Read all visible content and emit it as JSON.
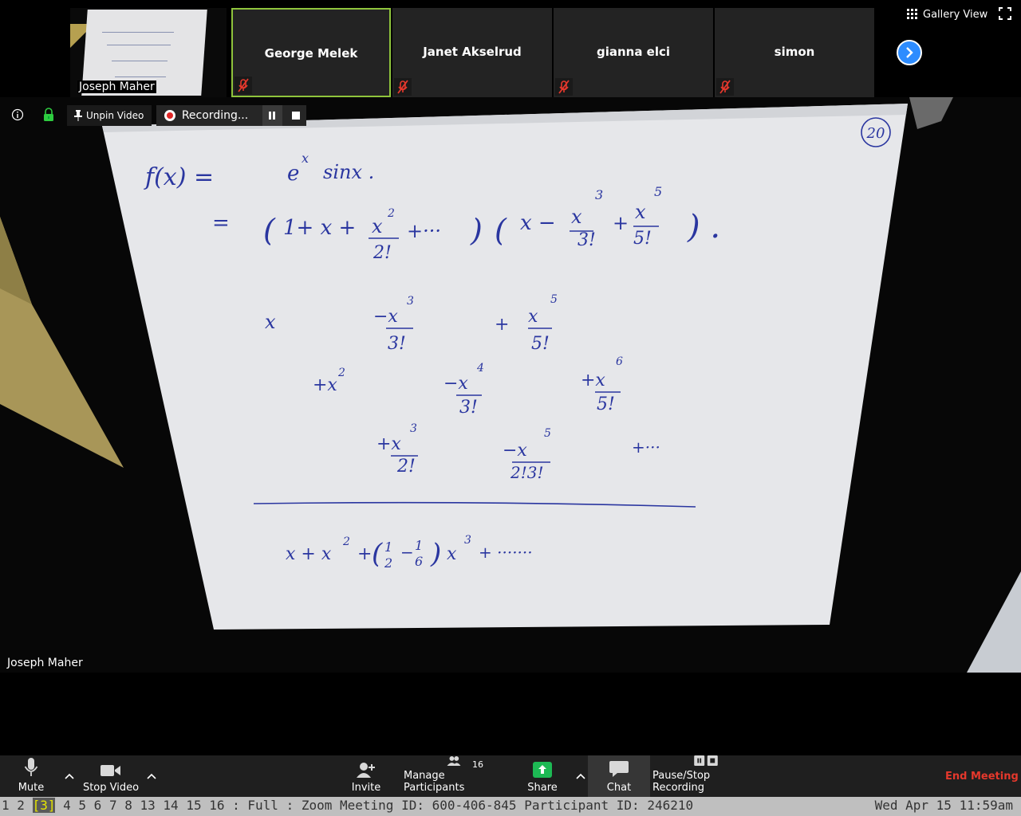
{
  "top_strip": {
    "self_tile": {
      "name": "Joseph Maher"
    },
    "participants": [
      {
        "name": "George Melek",
        "active": true
      },
      {
        "name": "Janet Akselrud",
        "active": false
      },
      {
        "name": "gianna elci",
        "active": false
      },
      {
        "name": "simon",
        "active": false
      }
    ],
    "gallery_view_label": "Gallery View"
  },
  "info_bar": {
    "unpin_label": "Unpin Video",
    "recording_label": "Recording..."
  },
  "main_video": {
    "speaker_name": "Joseph Maher",
    "board_corner_label": "20"
  },
  "toolbar": {
    "mute_label": "Mute",
    "stop_video_label": "Stop Video",
    "invite_label": "Invite",
    "manage_participants_label": "Manage Participants",
    "participant_count": "16",
    "share_label": "Share",
    "chat_label": "Chat",
    "pause_stop_recording_label": "Pause/Stop Recording",
    "end_meeting_label": "End Meeting"
  },
  "status_bar": {
    "windows": [
      "1",
      "2",
      "[3]",
      "4",
      "5",
      "6",
      "7",
      "8",
      "13",
      "14",
      "15",
      "16"
    ],
    "active_window": "[3]",
    "mode_text": ": Full : Zoom Meeting ID: 600-406-845 Participant ID: 246210",
    "clock": "Wed Apr 15 11:59am"
  },
  "colors": {
    "active_speaker_border": "#8fc43c",
    "end_meeting": "#e5382c",
    "share_green": "#1db954",
    "next_button_blue": "#2d8cff",
    "ink": "#2a36a0",
    "status_active": "#e6e600"
  }
}
